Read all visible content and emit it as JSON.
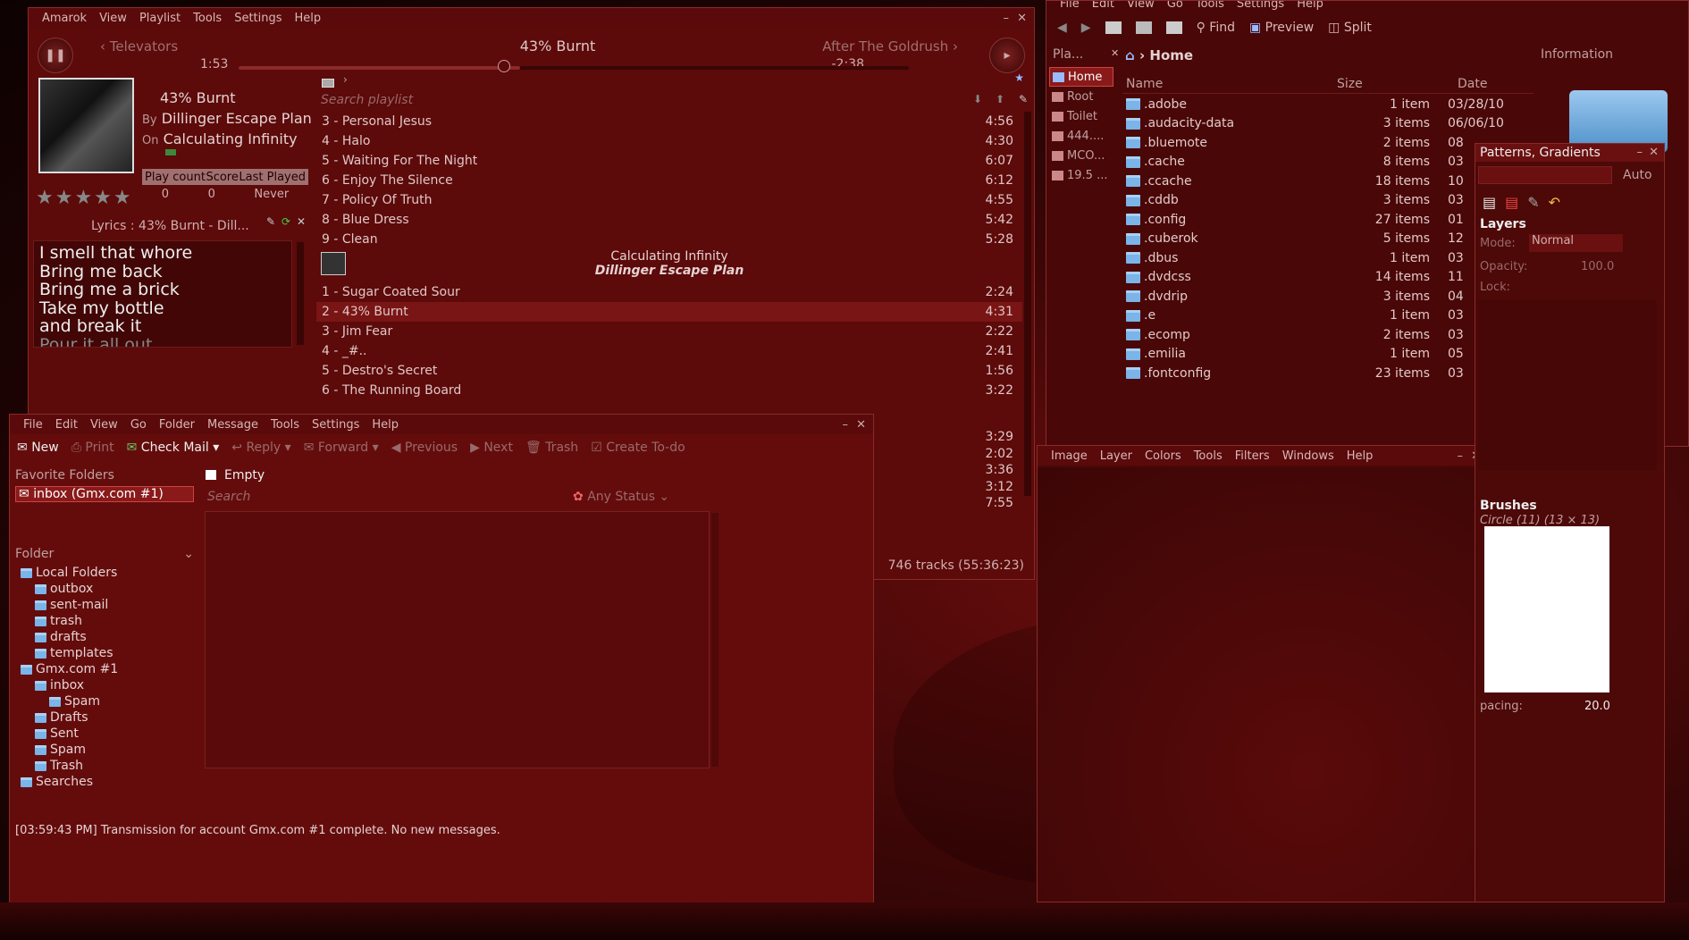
{
  "amarok": {
    "menu": [
      "Amarok",
      "View",
      "Playlist",
      "Tools",
      "Settings",
      "Help"
    ],
    "prev_track": "Televators",
    "now_title": "43% Burnt",
    "next_track": "After The Goldrush",
    "elapsed": "1:53",
    "remaining": "-2:38",
    "progress": 0.42,
    "track_title": "43% Burnt",
    "by_label": "By",
    "artist": "Dillinger Escape Plan",
    "on_label": "On",
    "album": "Calculating Infinity",
    "stats_headers": [
      "Play count",
      "Score",
      "Last Played"
    ],
    "stats_values": [
      "0",
      "0",
      "Never"
    ],
    "lyrics_title": "Lyrics : 43% Burnt - Dill...",
    "lyrics": [
      "I smell that whore",
      "Bring me back",
      "Bring me a brick",
      "Take my bottle",
      "and break it",
      "Pour it all out"
    ],
    "search_placeholder": "Search playlist",
    "playlist1": [
      [
        "3 - Personal Jesus",
        "4:56"
      ],
      [
        "4 - Halo",
        "4:30"
      ],
      [
        "5 - Waiting For The Night",
        "6:07"
      ],
      [
        "6 - Enjoy The Silence",
        "6:12"
      ],
      [
        "7 - Policy Of Truth",
        "4:55"
      ],
      [
        "8 - Blue Dress",
        "5:42"
      ],
      [
        "9 - Clean",
        "5:28"
      ]
    ],
    "group_album": "Calculating Infinity",
    "group_artist": "Dillinger Escape Plan",
    "playlist2": [
      [
        "1 - Sugar Coated Sour",
        "2:24"
      ],
      [
        "2 - 43% Burnt",
        "4:31"
      ],
      [
        "3 - Jim Fear",
        "2:22"
      ],
      [
        "4 - _#..",
        "2:41"
      ],
      [
        "5 - Destro's Secret",
        "1:56"
      ],
      [
        "6 - The Running Board",
        "3:22"
      ]
    ],
    "hidden_times": [
      "3:29",
      "2:02",
      "3:36",
      "3:12",
      "7:55"
    ],
    "footer": "746 tracks (55:36:23)"
  },
  "fm": {
    "menu": [
      "File",
      "Edit",
      "View",
      "Go",
      "Tools",
      "Settings",
      "Help"
    ],
    "toolbar": [
      "Find",
      "Preview",
      "Split"
    ],
    "places_title": "Pla...",
    "breadcrumb": "Home",
    "info_title": "Information",
    "places": [
      "Home",
      "Root",
      "Toilet",
      "444....",
      "MCO...",
      "19.5 ..."
    ],
    "columns": [
      "Name",
      "Size",
      "Date"
    ],
    "files": [
      [
        ".adobe",
        "1 item",
        "03/28/10"
      ],
      [
        ".audacity-data",
        "3 items",
        "06/06/10"
      ],
      [
        ".bluemote",
        "2 items",
        "08"
      ],
      [
        ".cache",
        "8 items",
        "03"
      ],
      [
        ".ccache",
        "18 items",
        "10"
      ],
      [
        ".cddb",
        "3 items",
        "03"
      ],
      [
        ".config",
        "27 items",
        "01"
      ],
      [
        ".cuberok",
        "5 items",
        "12"
      ],
      [
        ".dbus",
        "1 item",
        "03"
      ],
      [
        ".dvdcss",
        "14 items",
        "11"
      ],
      [
        ".dvdrip",
        "3 items",
        "04"
      ],
      [
        ".e",
        "1 item",
        "03"
      ],
      [
        ".ecomp",
        "2 items",
        "03"
      ],
      [
        ".emilia",
        "1 item",
        "05"
      ],
      [
        ".fontconfig",
        "23 items",
        "03"
      ]
    ]
  },
  "kmail": {
    "menu": [
      "File",
      "Edit",
      "View",
      "Go",
      "Folder",
      "Message",
      "Tools",
      "Settings",
      "Help"
    ],
    "toolbar": [
      "New",
      "Print",
      "Check Mail",
      "Reply",
      "Forward",
      "Previous",
      "Next",
      "Trash",
      "Create To-do"
    ],
    "fav_title": "Favorite Folders",
    "fav_item": "inbox (Gmx.com #1)",
    "folder_label": "Folder",
    "tree": [
      "Local Folders",
      "outbox",
      "sent-mail",
      "trash",
      "drafts",
      "templates",
      "Gmx.com #1",
      "inbox",
      "Spam",
      "Drafts",
      "Sent",
      "Spam",
      "Trash",
      "Searches"
    ],
    "tab": "Empty",
    "search_placeholder": "Search",
    "status_filter": "Any Status",
    "statusbar": "[03:59:43 PM] Transmission for account Gmx.com #1 complete. No new messages."
  },
  "gimp": {
    "menu": [
      "Image",
      "Layer",
      "Colors",
      "Tools",
      "Filters",
      "Windows",
      "Help"
    ]
  },
  "gimpdock": {
    "title": "Patterns, Gradients",
    "auto": "Auto",
    "layers": "Layers",
    "mode_label": "Mode:",
    "mode_value": "Normal",
    "opacity_label": "Opacity:",
    "opacity_value": "100.0",
    "lock_label": "Lock:",
    "brushes": "Brushes",
    "brush_name": "Circle (11) (13 × 13)",
    "spacing_label": "pacing:",
    "spacing_value": "20.0"
  }
}
